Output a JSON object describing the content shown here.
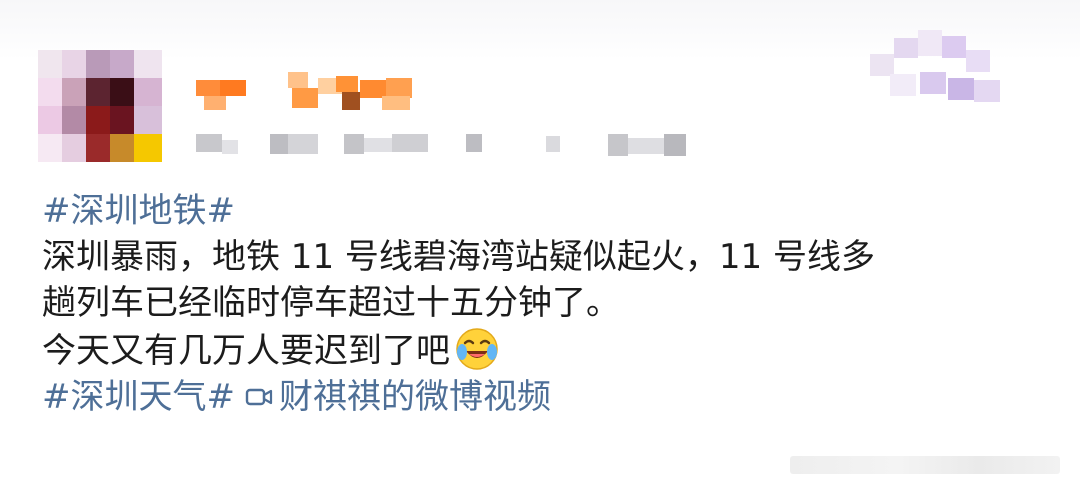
{
  "post": {
    "hashtag_1": "#深圳地铁#",
    "body_line_1": "深圳暴雨，地铁 11 号线碧海湾站疑似起火，11 号线多",
    "body_line_2": "趟列车已经临时停车超过十五分钟了。",
    "body_line_3": "今天又有几万人要迟到了吧",
    "emoji_name": "laughing-crying-emoji",
    "hashtag_2": "#深圳天气#",
    "video_link_label": "财祺祺的微博视频",
    "video_icon": "video-icon"
  },
  "colors": {
    "hashtag": "#4e6f97",
    "text": "#1c1c1c",
    "username_pixels": "#ff8c3a",
    "avatar_pixels": "#8b1a1a"
  }
}
